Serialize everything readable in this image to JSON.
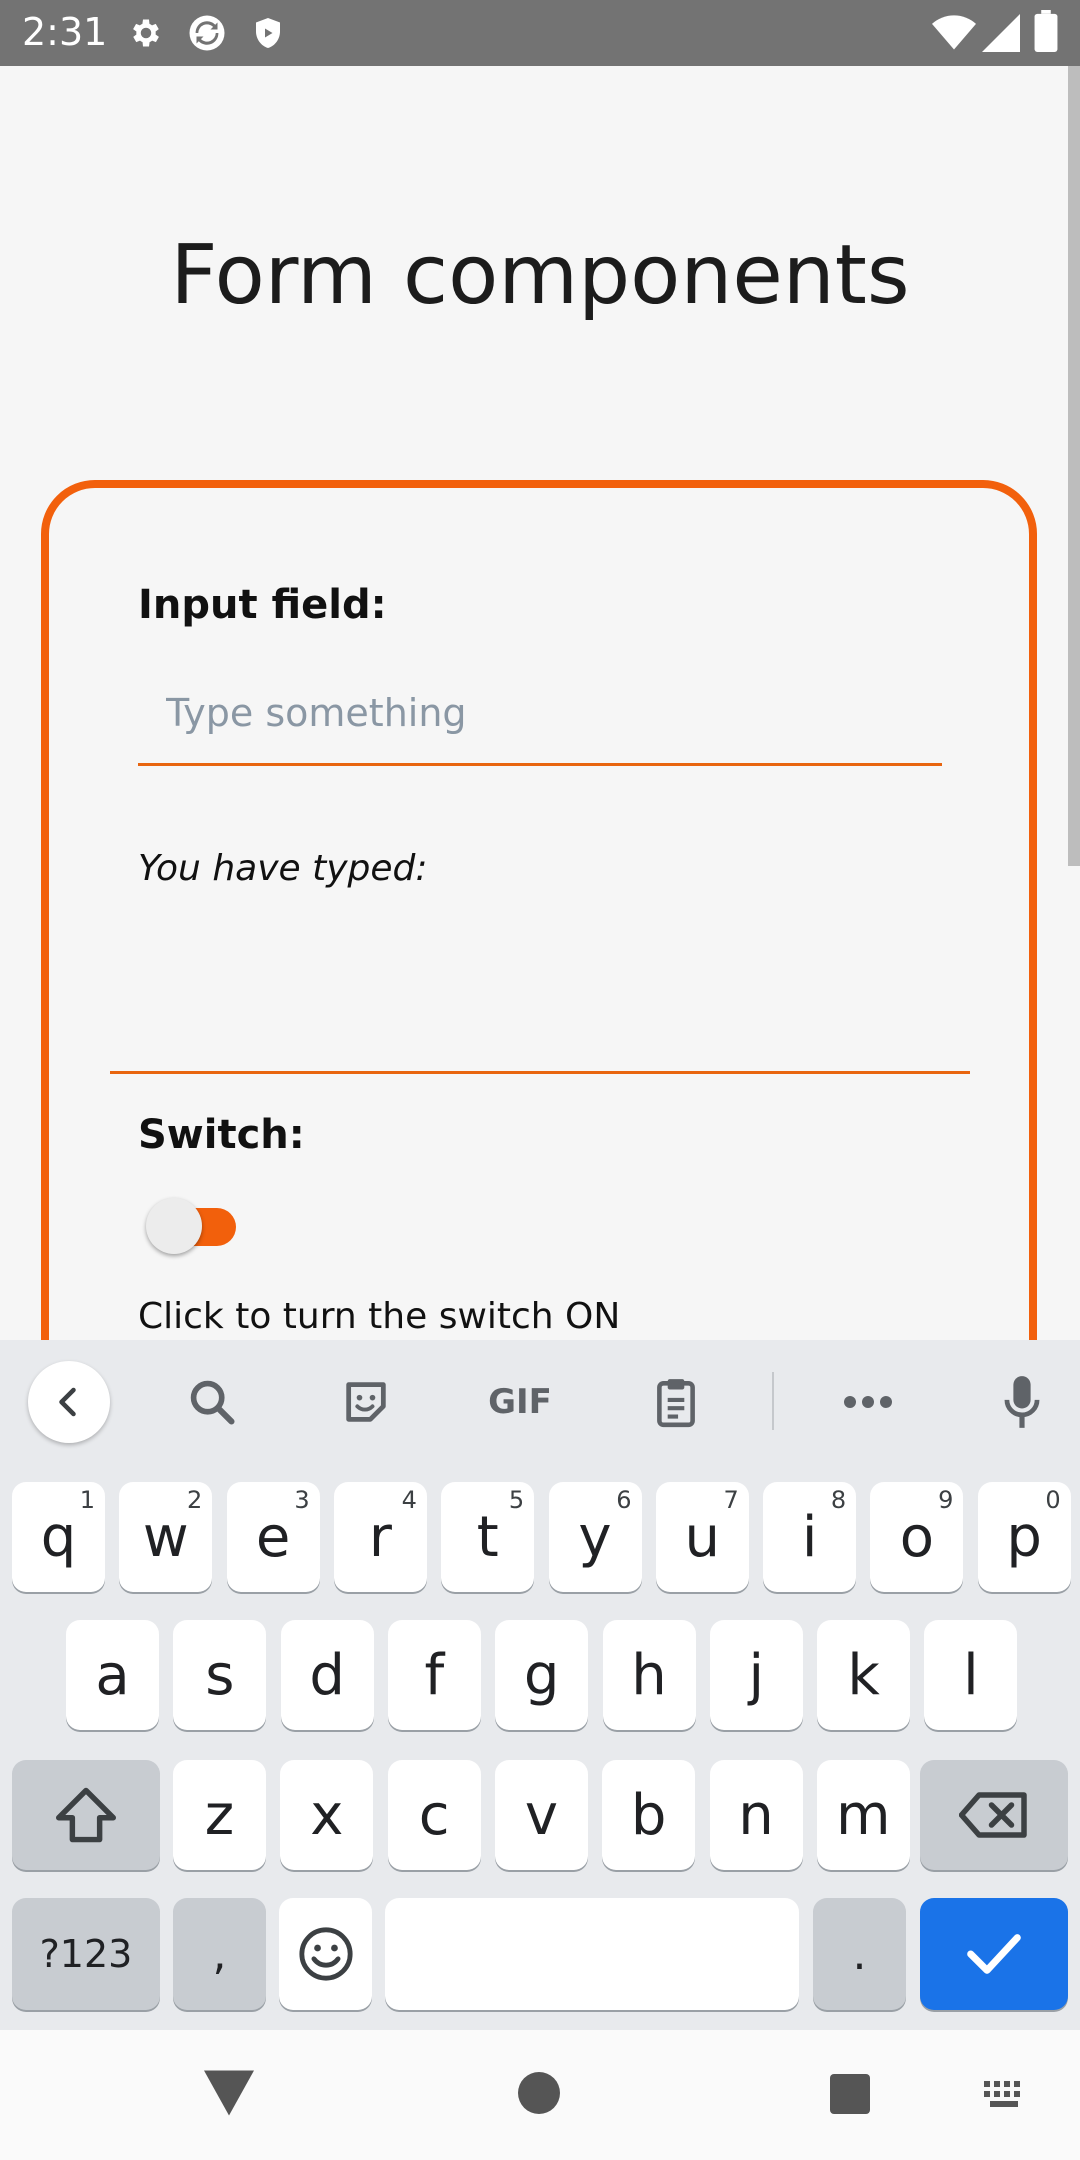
{
  "status_bar": {
    "time": "2:31",
    "icons": [
      "gear-icon",
      "sync-icon",
      "shield-icon",
      "wifi-icon",
      "signal-icon",
      "battery-icon"
    ]
  },
  "page": {
    "title": "Form components"
  },
  "form": {
    "input_label": "Input field:",
    "input_placeholder": "Type something",
    "input_value": "",
    "typed_label": "You have typed:",
    "typed_value": "",
    "switch_label": "Switch:",
    "switch_on": false,
    "switch_hint": "Click to turn the switch ON"
  },
  "colors": {
    "accent": "#f2600c",
    "keyboard_bg": "#e8eaed",
    "enter_key": "#1a73e8"
  },
  "keyboard": {
    "toolbar": [
      "back-icon",
      "search-icon",
      "sticker-icon",
      "GIF",
      "clipboard-icon",
      "more-icon",
      "mic-icon"
    ],
    "row1": [
      {
        "key": "q",
        "hint": "1"
      },
      {
        "key": "w",
        "hint": "2"
      },
      {
        "key": "e",
        "hint": "3"
      },
      {
        "key": "r",
        "hint": "4"
      },
      {
        "key": "t",
        "hint": "5"
      },
      {
        "key": "y",
        "hint": "6"
      },
      {
        "key": "u",
        "hint": "7"
      },
      {
        "key": "i",
        "hint": "8"
      },
      {
        "key": "o",
        "hint": "9"
      },
      {
        "key": "p",
        "hint": "0"
      }
    ],
    "row2": [
      "a",
      "s",
      "d",
      "f",
      "g",
      "h",
      "j",
      "k",
      "l"
    ],
    "row3": [
      "z",
      "x",
      "c",
      "v",
      "b",
      "n",
      "m"
    ],
    "symbols_key": "?123",
    "comma_key": ",",
    "period_key": "."
  },
  "nav_bar": {
    "icons": [
      "back-triangle-icon",
      "home-circle-icon",
      "recents-square-icon",
      "keyboard-switch-icon"
    ]
  }
}
